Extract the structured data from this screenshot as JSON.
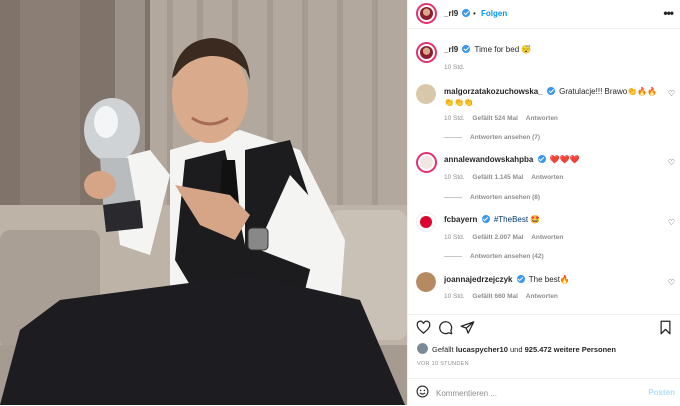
{
  "post": {
    "author": "_rl9",
    "follow_label": "Folgen",
    "separator": "•",
    "more_label": "•••",
    "caption": "Time for bed 😴",
    "caption_time": "10 Std."
  },
  "comments": [
    {
      "user": "malgorzatakozuchowska_",
      "verified": true,
      "text": "Gratulacje!!! Brawo👏🔥🔥👏👏👏",
      "time": "10 Std.",
      "likes": "Gefällt 524 Mal",
      "reply": "Antworten",
      "view_replies": "Antworten ansehen (7)",
      "avatar_color": "#d8c7a8"
    },
    {
      "user": "annalewandowskahpba",
      "verified": true,
      "text": "❤️❤️❤️",
      "time": "10 Std.",
      "likes": "Gefällt 1.145 Mal",
      "reply": "Antworten",
      "view_replies": "Antworten ansehen (8)",
      "avatar_color": "#f2e6e1"
    },
    {
      "user": "fcbayern",
      "verified": true,
      "text": "#TheBest 🤩",
      "time": "10 Std.",
      "likes": "Gefällt 2.007 Mal",
      "reply": "Antworten",
      "view_replies": "Antworten ansehen (42)",
      "avatar_color": "#dc052d"
    },
    {
      "user": "joannajedrzejczyk",
      "verified": true,
      "text": "The best🔥",
      "time": "10 Std.",
      "likes": "Gefällt 660 Mal",
      "reply": "Antworten",
      "avatar_color": "#b58a63"
    }
  ],
  "likes_line": {
    "prefix": "Gefällt",
    "user": "lucaspycher10",
    "middle": "und",
    "count": "925.472 weitere Personen"
  },
  "posted_ago": "VOR 10 STUNDEN",
  "comment_box": {
    "placeholder": "Kommentieren ...",
    "post_label": "Posten"
  },
  "icons": {
    "like": "heart-icon",
    "comment": "comment-icon",
    "share": "paper-plane-icon",
    "save": "bookmark-icon",
    "emoji": "emoji-icon",
    "more": "more-options-icon"
  },
  "colors": {
    "accent": "#0095f6",
    "verified": "#3897f0",
    "heart_red": "#ed4956",
    "story_ring": "#e1306c"
  }
}
